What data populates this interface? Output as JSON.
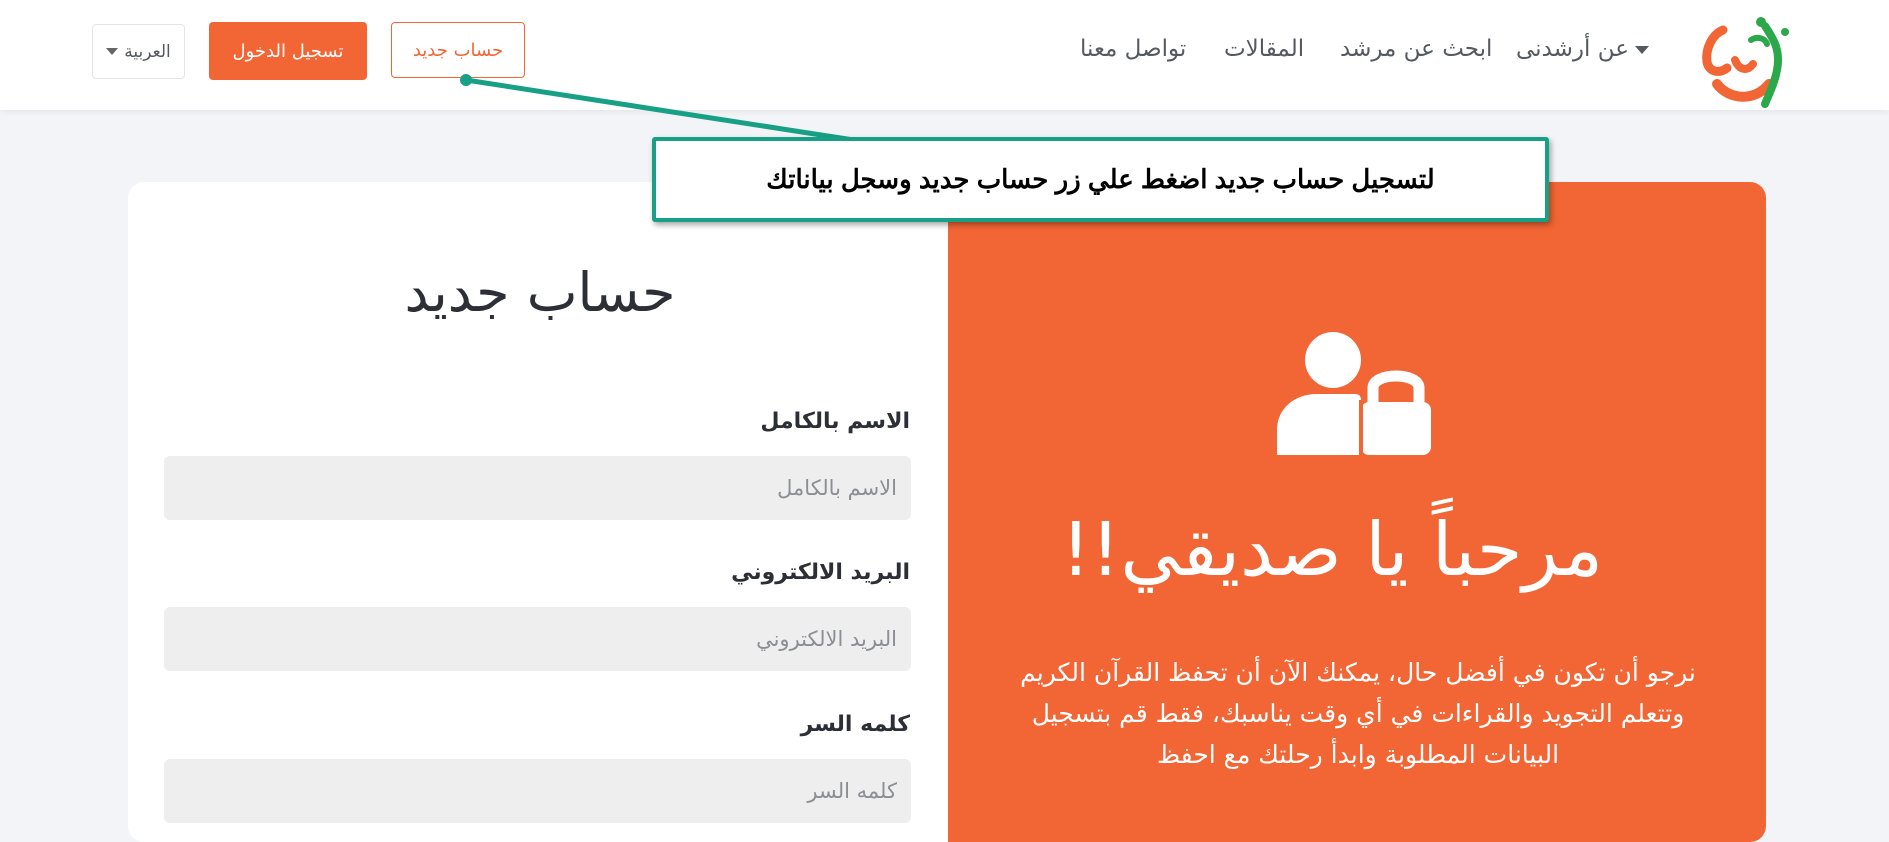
{
  "nav": {
    "logo_alt": "أرشدني",
    "about_label": "عن أرشدنى",
    "search_mentor_label": "ابحث عن مرشد",
    "articles_label": "المقالات",
    "contact_label": "تواصل معنا",
    "new_account_button": "حساب جديد",
    "login_button": "تسجيل الدخول",
    "language_label": "العربية"
  },
  "callout": {
    "text": "لتسجيل حساب جديد اضغط علي زر حساب جديد وسجل بياناتك"
  },
  "welcome": {
    "icon": "user-lock-icon",
    "title": "مرحباً يا صديقي!!",
    "text": "نرجو أن تكون في أفضل حال، يمكنك الآن أن تحفظ القرآن الكريم وتتعلم التجويد والقراءات في أي وقت يناسبك، فقط قم بتسجيل البيانات المطلوبة وابدأ رحلتك مع احفظ"
  },
  "form": {
    "title": "حساب جديد",
    "full_name": {
      "label": "الاسم بالكامل",
      "placeholder": "الاسم بالكامل",
      "value": ""
    },
    "email": {
      "label": "البريد الالكتروني",
      "placeholder": "البريد الالكتروني",
      "value": ""
    },
    "password": {
      "label": "كلمه السر",
      "placeholder": "كلمه السر",
      "value": ""
    }
  },
  "colors": {
    "brand_orange": "#f26534",
    "brand_green": "#2aa84a",
    "callout_border": "#17a085",
    "input_bg": "#eeeeee"
  }
}
